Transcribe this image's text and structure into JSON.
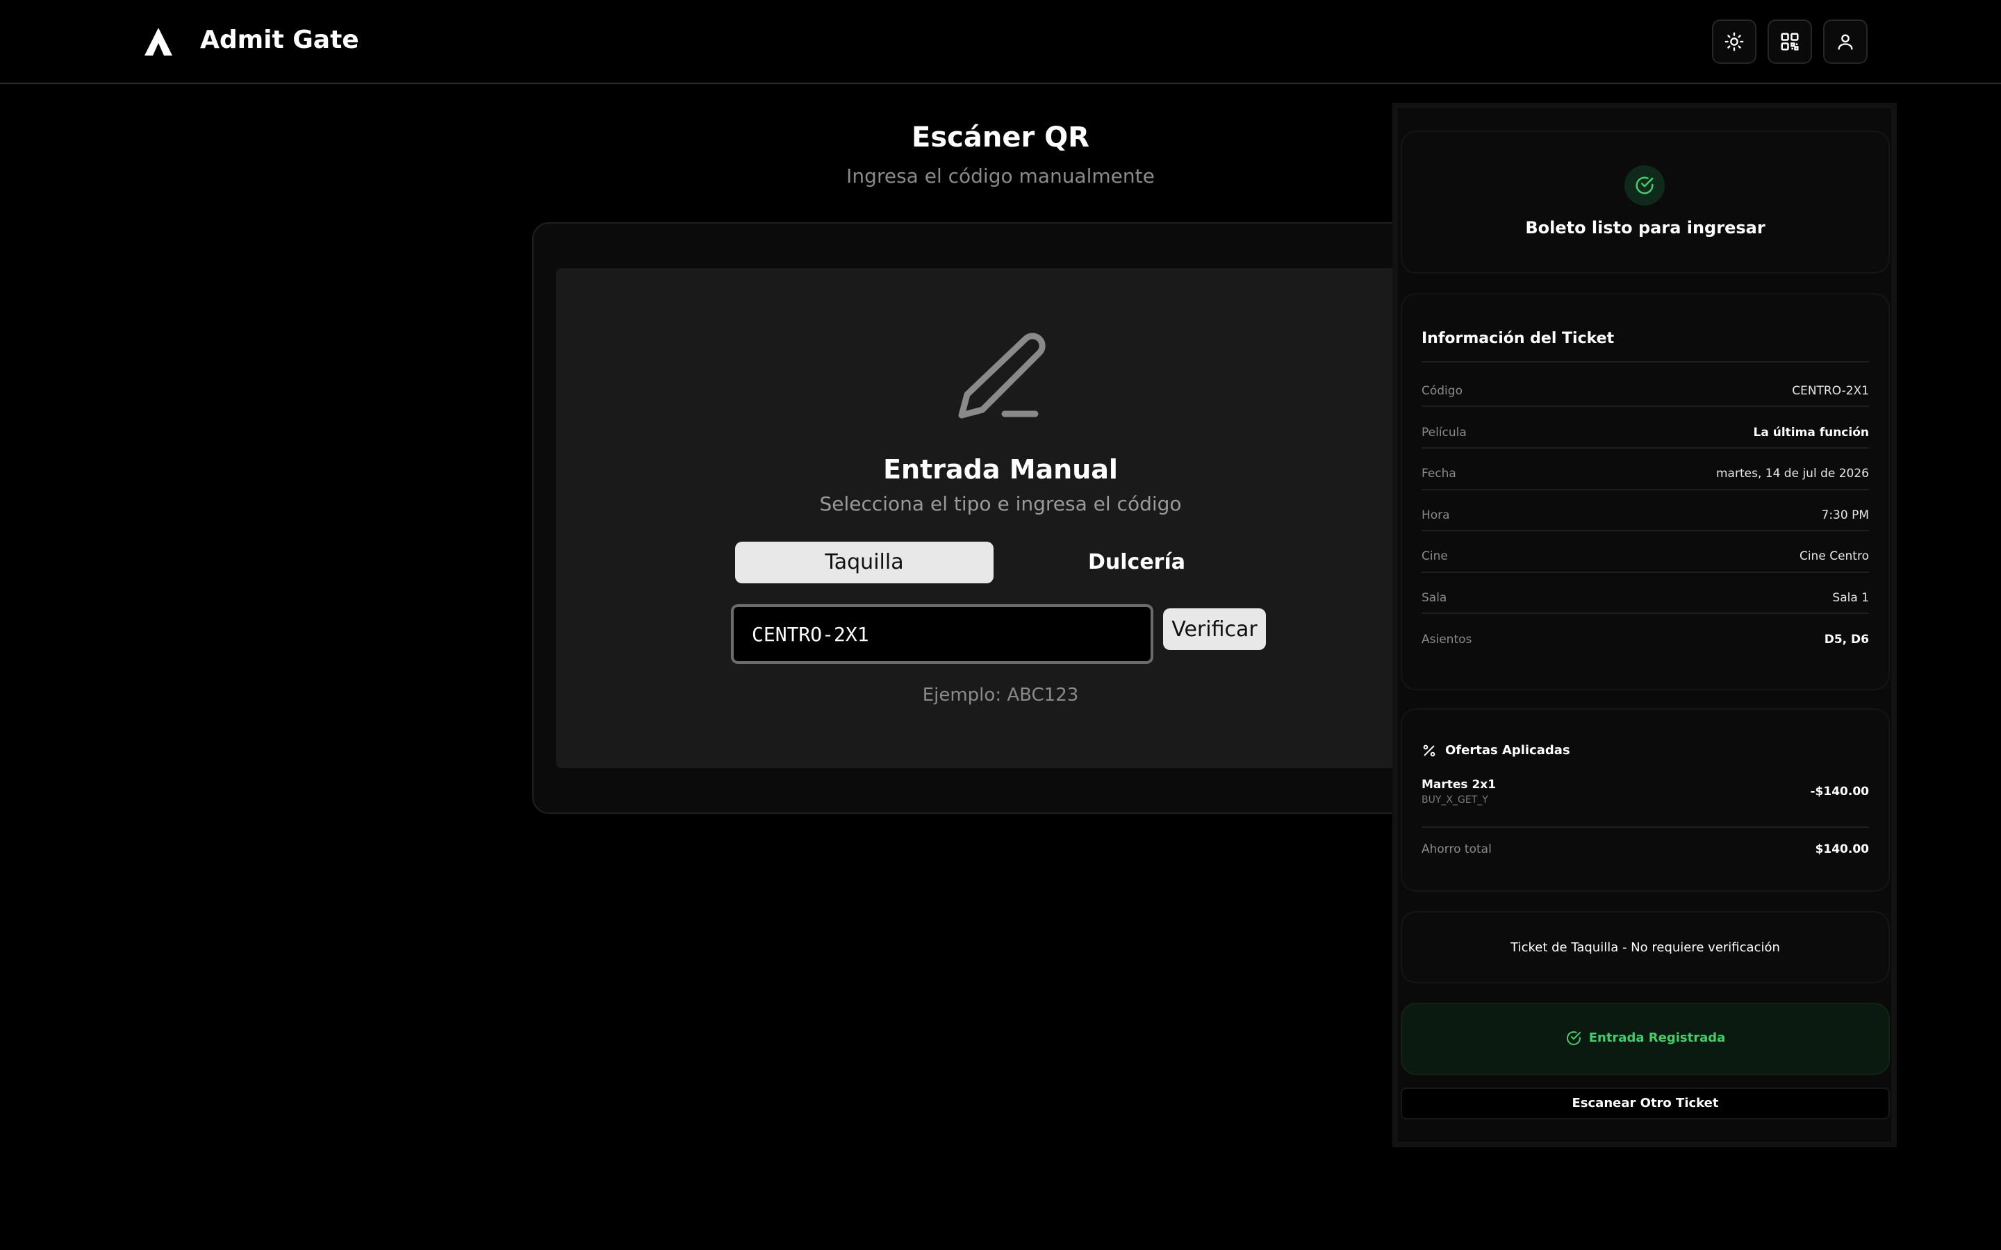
{
  "app": {
    "title": "Admit Gate"
  },
  "header": {
    "icons": [
      "sun-icon",
      "qr-code-icon",
      "user-icon"
    ]
  },
  "page": {
    "title": "Escáner QR",
    "subtitle": "Ingresa el código manualmente"
  },
  "manual": {
    "title": "Entrada Manual",
    "subtitle": "Selecciona el tipo e ingresa el código",
    "tabs": [
      {
        "label": "Taquilla",
        "active": true
      },
      {
        "label": "Dulcería",
        "active": false
      }
    ],
    "code_value": "CENTRO-2X1",
    "verify_label": "Verificar",
    "example": "Ejemplo: ABC123"
  },
  "status": {
    "text": "Boleto listo para ingresar",
    "color": "#3ecf6a"
  },
  "ticket": {
    "title": "Información del Ticket",
    "rows": [
      {
        "label": "Código",
        "value": "CENTRO-2X1"
      },
      {
        "label": "Película",
        "value": "La última función"
      },
      {
        "label": "Fecha",
        "value": "martes, 14 de jul de 2026"
      },
      {
        "label": "Hora",
        "value": "7:30 PM"
      },
      {
        "label": "Cine",
        "value": "Cine Centro"
      },
      {
        "label": "Sala",
        "value": "Sala 1"
      },
      {
        "label": "Asientos",
        "value": "D5, D6"
      }
    ]
  },
  "offers": {
    "title": "Ofertas Aplicadas",
    "items": [
      {
        "name": "Martes 2x1",
        "code": "BUY_X_GET_Y",
        "amount": "-$140.00"
      }
    ],
    "total_label": "Ahorro total",
    "total_value": "$140.00"
  },
  "notice": "Ticket de Taquilla - No requiere verificación",
  "entry": {
    "label": "Entrada Registrada",
    "color": "#3ecf6a"
  },
  "scan_again": "Escanear Otro Ticket"
}
